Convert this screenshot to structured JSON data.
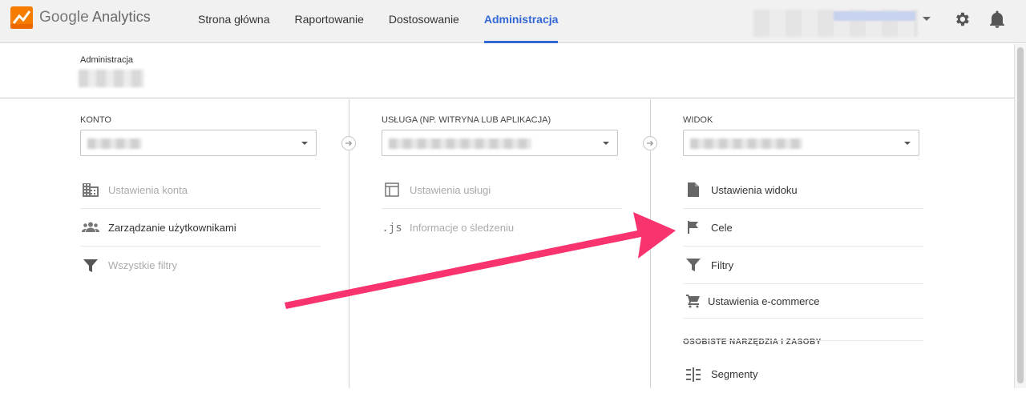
{
  "app": {
    "logo_google": "Google",
    "logo_analytics": "Analytics"
  },
  "nav": {
    "items": [
      {
        "label": "Strona główna"
      },
      {
        "label": "Raportowanie"
      },
      {
        "label": "Dostosowanie"
      },
      {
        "label": "Administracja",
        "active": true
      }
    ]
  },
  "header": {
    "breadcrumb_label": "Administracja"
  },
  "columns": {
    "account": {
      "title": "KONTO",
      "items": [
        {
          "label": "Ustawienia konta",
          "icon": "building-icon",
          "enabled": false
        },
        {
          "label": "Zarządzanie użytkownikami",
          "icon": "users-icon",
          "enabled": true
        },
        {
          "label": "Wszystkie filtry",
          "icon": "filter-icon",
          "enabled": false
        }
      ]
    },
    "property": {
      "title": "USŁUGA (NP. WITRYNA LUB APLIKACJA)",
      "items": [
        {
          "label": "Ustawienia usługi",
          "icon": "window-icon",
          "enabled": false
        },
        {
          "label": "Informacje o śledzeniu",
          "icon": "js-icon",
          "enabled": false
        }
      ]
    },
    "view": {
      "title": "WIDOK",
      "items": [
        {
          "label": "Ustawienia widoku",
          "icon": "document-icon",
          "enabled": true
        },
        {
          "label": "Cele",
          "icon": "flag-icon",
          "enabled": true
        },
        {
          "label": "Filtry",
          "icon": "filter-icon",
          "enabled": true
        },
        {
          "label": "Ustawienia e-commerce",
          "icon": "cart-icon",
          "enabled": true
        }
      ],
      "section_title": "OSOBISTE NARZĘDZIA I ZASOBY",
      "section_items": [
        {
          "label": "Segmenty",
          "icon": "segments-icon",
          "enabled": true
        }
      ]
    }
  },
  "colors": {
    "accent": "#3367d6",
    "annotation_arrow": "#f8336e",
    "icon_dim": "#b0b0b0",
    "icon_dark": "#666666"
  }
}
